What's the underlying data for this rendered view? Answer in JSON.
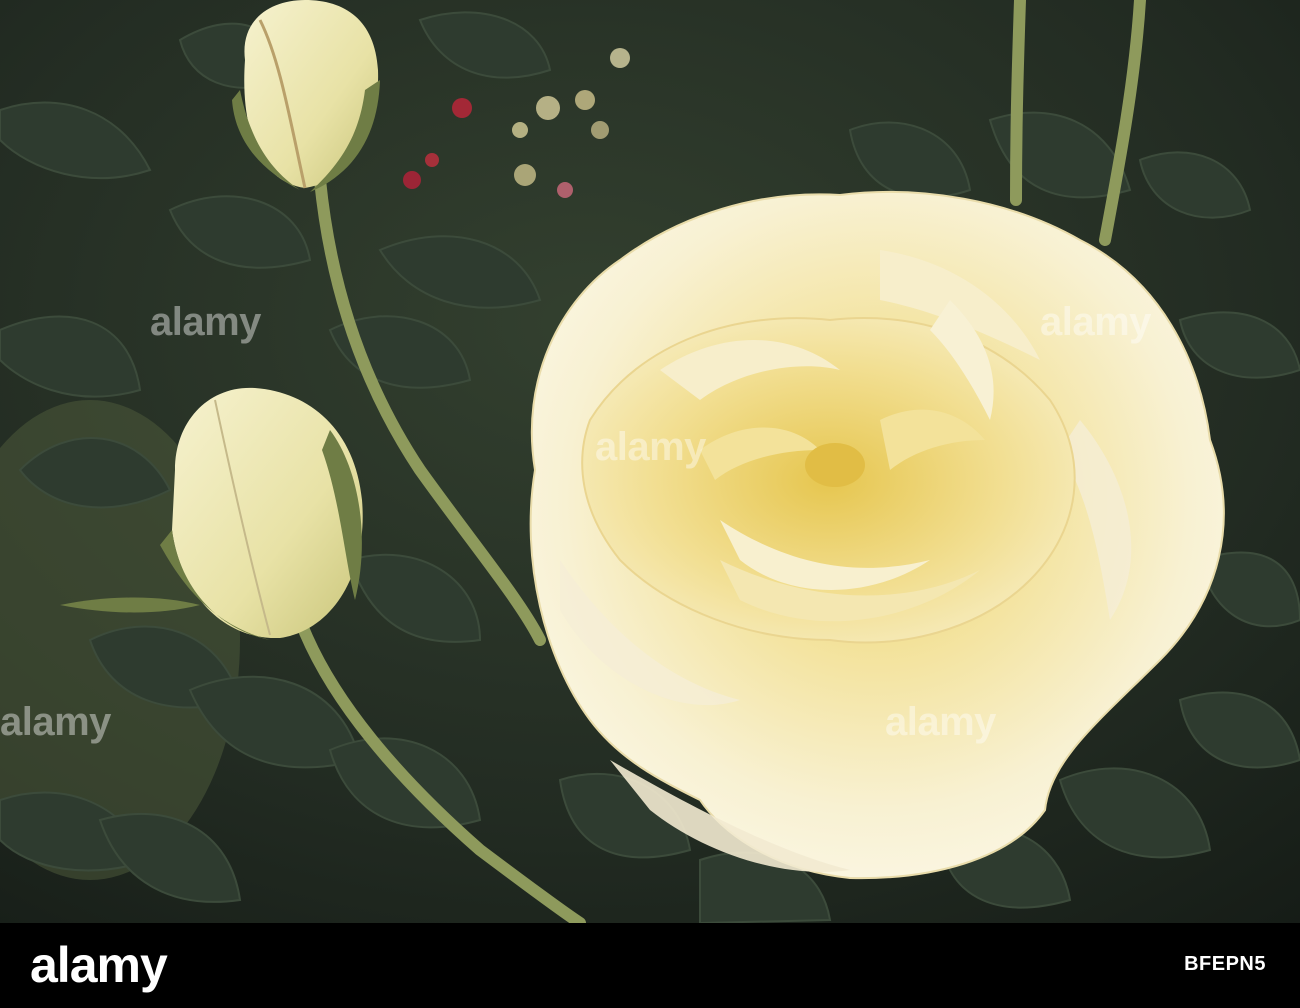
{
  "watermark": {
    "text": "alamy"
  },
  "footer": {
    "logo_text": "alamy",
    "image_id": "BFEPN5"
  },
  "colors": {
    "background_foliage": "#1f2a20",
    "leaf": "#2c3a2e",
    "stem": "#8e9a5c",
    "petal": "#f6f0cf",
    "petal_center": "#ecd779",
    "footer": "#000000"
  }
}
